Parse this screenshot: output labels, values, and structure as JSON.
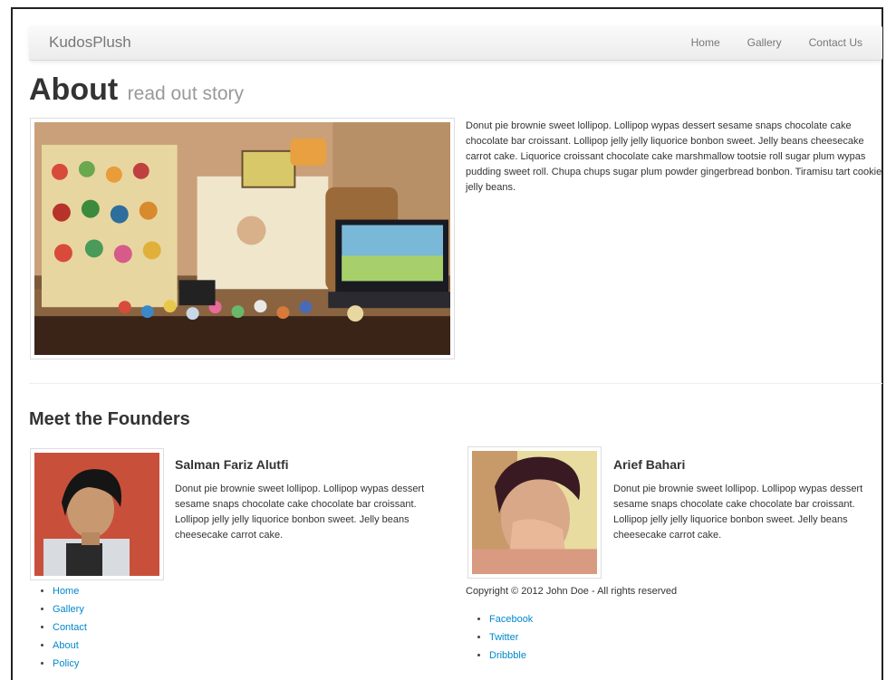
{
  "navbar": {
    "brand": "KudosPlush",
    "links": [
      "Home",
      "Gallery",
      "Contact Us"
    ]
  },
  "about": {
    "title": "About",
    "subtitle": "read out story",
    "paragraph": "Donut pie brownie sweet lollipop. Lollipop wypas dessert sesame snaps chocolate cake chocolate bar croissant. Lollipop jelly jelly liquorice bonbon sweet. Jelly beans cheesecake carrot cake. Liquorice croissant chocolate cake marshmallow tootsie roll sugar plum wypas pudding sweet roll. Chupa chups sugar plum powder gingerbread bonbon. Tiramisu tart cookie jelly beans."
  },
  "founders": {
    "title": "Meet the Founders",
    "people": [
      {
        "name": "Salman Fariz Alutfi",
        "bio": "Donut pie brownie sweet lollipop. Lollipop wypas dessert sesame snaps chocolate cake chocolate bar croissant. Lollipop jelly jelly liquorice bonbon sweet. Jelly beans cheesecake carrot cake."
      },
      {
        "name": "Arief Bahari",
        "bio": "Donut pie brownie sweet lollipop. Lollipop wypas dessert sesame snaps chocolate cake chocolate bar croissant. Lollipop jelly jelly liquorice bonbon sweet. Jelly beans cheesecake carrot cake."
      }
    ]
  },
  "footer": {
    "nav": [
      "Home",
      "Gallery",
      "Contact",
      "About",
      "Policy"
    ],
    "copyright": "Copyright © 2012 John Doe - All rights reserved",
    "social": [
      "Facebook",
      "Twitter",
      "Dribbble"
    ]
  },
  "colors": {
    "link": "#0088cc",
    "subtitle": "#999999",
    "navbar_bg": "#f2f2f2"
  }
}
